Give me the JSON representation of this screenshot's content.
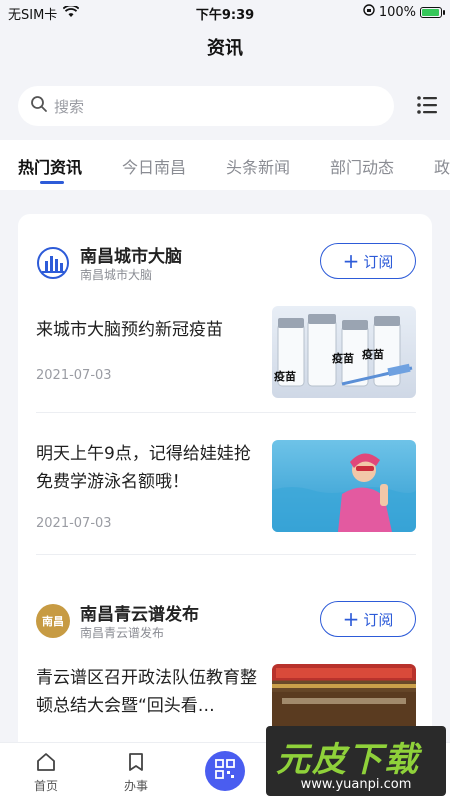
{
  "status_bar": {
    "carrier": "无SIM卡",
    "time": "下午9:39",
    "battery": "100%",
    "battery_level": 1.0
  },
  "header": {
    "title": "资讯"
  },
  "search": {
    "placeholder": "搜索"
  },
  "tabs": [
    {
      "label": "热门资讯",
      "active": true
    },
    {
      "label": "今日南昌",
      "active": false
    },
    {
      "label": "头条新闻",
      "active": false
    },
    {
      "label": "部门动态",
      "active": false
    },
    {
      "label": "政",
      "active": false
    }
  ],
  "channels": [
    {
      "name": "南昌城市大脑",
      "subtitle": "南昌城市大脑",
      "subscribe_label": "订阅",
      "articles": [
        {
          "title": "来城市大脑预约新冠疫苗",
          "date": "2021-07-03",
          "thumb_text": [
            "疫苗",
            "疫苗",
            "疫苗"
          ]
        },
        {
          "title": "明天上午9点，记得给娃娃抢免费学游泳名额哦！",
          "date": "2021-07-03"
        }
      ]
    },
    {
      "name": "南昌青云谱发布",
      "subtitle": "南昌青云谱发布",
      "subscribe_label": "订阅",
      "logo_text": "南昌",
      "articles": [
        {
          "title": "青云谱区召开政法队伍教育整顿总结大会暨“回头看…"
        }
      ]
    }
  ],
  "tabbar": {
    "home": "首页",
    "tasks": "办事"
  },
  "watermark": {
    "text": "元皮下载",
    "url": "www.yuanpi.com"
  },
  "colors": {
    "accent": "#2d5bd8",
    "fab": "#4a5df0",
    "background": "#f3f4f8"
  }
}
